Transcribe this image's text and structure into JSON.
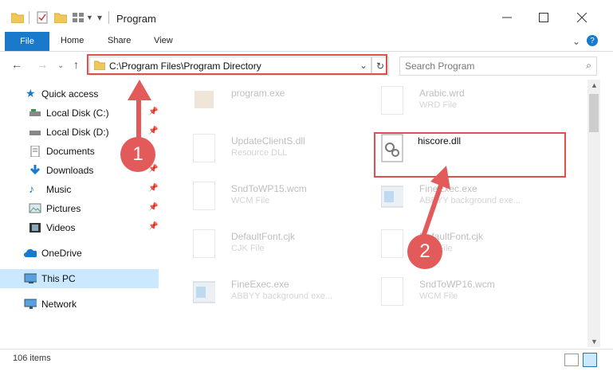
{
  "window": {
    "title": "Program"
  },
  "ribbon": {
    "file": "File",
    "tabs": [
      "Home",
      "Share",
      "View"
    ]
  },
  "nav": {
    "back_glyph": "←",
    "forward_glyph": "→",
    "up_glyph": "↑",
    "address": "C:\\Program Files\\Program Directory",
    "search_placeholder": "Search Program"
  },
  "sidebar": {
    "items": [
      {
        "label": "Quick access",
        "icon": "star-icon"
      },
      {
        "label": "Local Disk (C:)",
        "icon": "drive-icon"
      },
      {
        "label": "Local Disk (D:)",
        "icon": "drive-icon"
      },
      {
        "label": "Documents",
        "icon": "documents-icon"
      },
      {
        "label": "Downloads",
        "icon": "download-icon"
      },
      {
        "label": "Music",
        "icon": "music-icon"
      },
      {
        "label": "Pictures",
        "icon": "pictures-icon"
      },
      {
        "label": "Videos",
        "icon": "videos-icon"
      },
      {
        "label": "OneDrive",
        "icon": "cloud-icon"
      },
      {
        "label": "This PC",
        "icon": "pc-icon"
      },
      {
        "label": "Network",
        "icon": "network-icon"
      }
    ]
  },
  "files": [
    {
      "name": "program.exe",
      "type": ""
    },
    {
      "name": "Arabic.wrd",
      "type": "WRD File"
    },
    {
      "name": "UpdateClientS.dll",
      "type": "Resource DLL"
    },
    {
      "name": "hiscore.dll",
      "type": ""
    },
    {
      "name": "SndToWP15.wcm",
      "type": "WCM File"
    },
    {
      "name": "FineExec.exe",
      "type": "ABBYY background exe..."
    },
    {
      "name": "DefaultFont.cjk",
      "type": "CJK File"
    },
    {
      "name": "DefaultFont.cjk",
      "type": "CJK File"
    },
    {
      "name": "FineExec.exe",
      "type": "ABBYY background exe..."
    },
    {
      "name": "SndToWP16.wcm",
      "type": "WCM File"
    }
  ],
  "status": {
    "count": "106 items"
  },
  "annotations": {
    "step1": "1",
    "step2": "2"
  },
  "colors": {
    "accent": "#1979ca",
    "callout": "#e24d4d"
  }
}
